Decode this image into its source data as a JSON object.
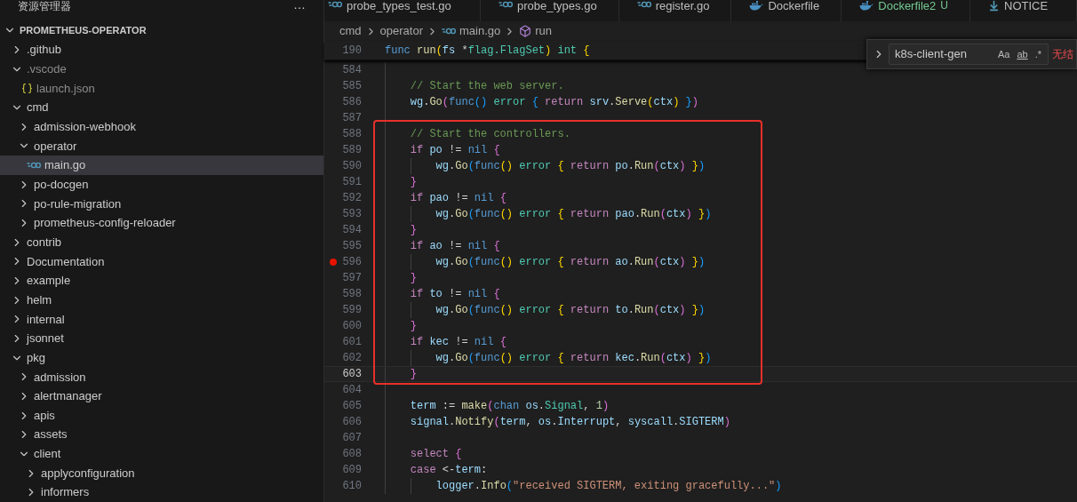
{
  "sidebar": {
    "title": "资源管理器",
    "more_button": "…",
    "root": {
      "title": "PROMETHEUS-OPERATOR",
      "expanded": true
    },
    "items": [
      {
        "name": ".github",
        "kind": "folder",
        "expanded": false,
        "selected": false,
        "dimmed": false
      },
      {
        "name": ".vscode",
        "kind": "folder",
        "expanded": true,
        "selected": false,
        "dimmed": true,
        "children": [
          {
            "name": "launch.json",
            "kind": "json",
            "selected": false,
            "dimmed": true
          }
        ]
      },
      {
        "name": "cmd",
        "kind": "folder",
        "expanded": true,
        "selected": false,
        "dimmed": false,
        "children": [
          {
            "name": "admission-webhook",
            "kind": "folder",
            "expanded": false,
            "selected": false,
            "dimmed": false
          },
          {
            "name": "operator",
            "kind": "folder",
            "expanded": true,
            "selected": false,
            "dimmed": false,
            "children": [
              {
                "name": "main.go",
                "kind": "go",
                "selected": true,
                "dimmed": false
              }
            ]
          },
          {
            "name": "po-docgen",
            "kind": "folder",
            "expanded": false,
            "selected": false,
            "dimmed": false
          },
          {
            "name": "po-rule-migration",
            "kind": "folder",
            "expanded": false,
            "selected": false,
            "dimmed": false
          },
          {
            "name": "prometheus-config-reloader",
            "kind": "folder",
            "expanded": false,
            "selected": false,
            "dimmed": false
          }
        ]
      },
      {
        "name": "contrib",
        "kind": "folder",
        "expanded": false,
        "selected": false,
        "dimmed": false
      },
      {
        "name": "Documentation",
        "kind": "folder",
        "expanded": false,
        "selected": false,
        "dimmed": false
      },
      {
        "name": "example",
        "kind": "folder",
        "expanded": false,
        "selected": false,
        "dimmed": false
      },
      {
        "name": "helm",
        "kind": "folder",
        "expanded": false,
        "selected": false,
        "dimmed": false
      },
      {
        "name": "internal",
        "kind": "folder",
        "expanded": false,
        "selected": false,
        "dimmed": false
      },
      {
        "name": "jsonnet",
        "kind": "folder",
        "expanded": false,
        "selected": false,
        "dimmed": false
      },
      {
        "name": "pkg",
        "kind": "folder",
        "expanded": true,
        "selected": false,
        "dimmed": false,
        "children": [
          {
            "name": "admission",
            "kind": "folder",
            "expanded": false,
            "selected": false,
            "dimmed": false
          },
          {
            "name": "alertmanager",
            "kind": "folder",
            "expanded": false,
            "selected": false,
            "dimmed": false
          },
          {
            "name": "apis",
            "kind": "folder",
            "expanded": false,
            "selected": false,
            "dimmed": false
          },
          {
            "name": "assets",
            "kind": "folder",
            "expanded": false,
            "selected": false,
            "dimmed": false
          },
          {
            "name": "client",
            "kind": "folder",
            "expanded": true,
            "selected": false,
            "dimmed": false,
            "children": [
              {
                "name": "applyconfiguration",
                "kind": "folder",
                "expanded": false,
                "selected": false,
                "dimmed": false
              },
              {
                "name": "informers",
                "kind": "folder",
                "expanded": false,
                "selected": false,
                "dimmed": false
              }
            ]
          }
        ]
      }
    ]
  },
  "tabs": [
    {
      "label": "probe_types_test.go",
      "kind": "go",
      "untracked": false
    },
    {
      "label": "probe_types.go",
      "kind": "go",
      "untracked": false
    },
    {
      "label": "register.go",
      "kind": "go",
      "untracked": false
    },
    {
      "label": "Dockerfile",
      "kind": "docker",
      "untracked": false
    },
    {
      "label": "Dockerfile2",
      "kind": "docker",
      "untracked": true,
      "badge": "U"
    },
    {
      "label": "NOTICE",
      "kind": "notice",
      "untracked": false
    }
  ],
  "breadcrumbs": [
    {
      "label": "cmd",
      "kind": "folder"
    },
    {
      "label": "operator",
      "kind": "folder"
    },
    {
      "label": "main.go",
      "kind": "go"
    },
    {
      "label": "run",
      "kind": "symbol"
    }
  ],
  "sticky_line": {
    "number": "190",
    "tokens": [
      {
        "text": "func ",
        "kind": "ctrl"
      },
      {
        "text": "run",
        "kind": "fn"
      },
      {
        "text": "(",
        "kind": "b1"
      },
      {
        "text": "fs ",
        "kind": "var"
      },
      {
        "text": "*",
        "kind": "plain"
      },
      {
        "text": "flag.FlagSet",
        "kind": "type"
      },
      {
        "text": ")",
        "kind": "b1"
      },
      {
        "text": " int ",
        "kind": "type"
      },
      {
        "text": "{",
        "kind": "b1"
      }
    ]
  },
  "find_widget": {
    "query": "k8s-client-gen",
    "options": [
      {
        "label": "Aa",
        "on": false
      },
      {
        "label": "ab",
        "on": false
      },
      {
        "label": ".*",
        "on": false
      }
    ],
    "result": "无结"
  },
  "lines": [
    {
      "number": "584",
      "breakpoint": false,
      "current": false
    },
    {
      "number": "585",
      "breakpoint": false,
      "current": false,
      "tokens": [
        {
          "text": "    // Start the web server.",
          "kind": "comment"
        }
      ]
    },
    {
      "number": "586",
      "breakpoint": false,
      "current": false,
      "tokens": [
        {
          "text": "    wg",
          "kind": "var"
        },
        {
          "text": ".",
          "kind": "plain"
        },
        {
          "text": "Go",
          "kind": "fn"
        },
        {
          "text": "(",
          "kind": "b2"
        },
        {
          "text": "func",
          "kind": "ctrl"
        },
        {
          "text": "()",
          "kind": "b3"
        },
        {
          "text": " error ",
          "kind": "type"
        },
        {
          "text": "{",
          "kind": "b3"
        },
        {
          "text": " return ",
          "kind": "kw"
        },
        {
          "text": "srv",
          "kind": "var"
        },
        {
          "text": ".",
          "kind": "plain"
        },
        {
          "text": "Serve",
          "kind": "fn"
        },
        {
          "text": "(",
          "kind": "b1"
        },
        {
          "text": "ctx",
          "kind": "var"
        },
        {
          "text": ")",
          "kind": "b1"
        },
        {
          "text": " }",
          "kind": "b3"
        },
        {
          "text": ")",
          "kind": "b2"
        }
      ]
    },
    {
      "number": "587",
      "breakpoint": false,
      "current": false
    },
    {
      "number": "588",
      "breakpoint": false,
      "current": false,
      "tokens": [
        {
          "text": "    // Start the controllers.",
          "kind": "comment"
        }
      ]
    },
    {
      "number": "589",
      "breakpoint": false,
      "current": false,
      "tokens": [
        {
          "text": "    if ",
          "kind": "kw"
        },
        {
          "text": "po",
          "kind": "var"
        },
        {
          "text": " != ",
          "kind": "plain"
        },
        {
          "text": "nil",
          "kind": "ctrl"
        },
        {
          "text": " {",
          "kind": "b2"
        }
      ]
    },
    {
      "number": "590",
      "breakpoint": false,
      "current": false,
      "tokens": [
        {
          "text": "        wg",
          "kind": "var"
        },
        {
          "text": ".",
          "kind": "plain"
        },
        {
          "text": "Go",
          "kind": "fn"
        },
        {
          "text": "(",
          "kind": "b3"
        },
        {
          "text": "func",
          "kind": "ctrl"
        },
        {
          "text": "()",
          "kind": "b1"
        },
        {
          "text": " error ",
          "kind": "type"
        },
        {
          "text": "{",
          "kind": "b1"
        },
        {
          "text": " return ",
          "kind": "kw"
        },
        {
          "text": "po",
          "kind": "var"
        },
        {
          "text": ".",
          "kind": "plain"
        },
        {
          "text": "Run",
          "kind": "fn"
        },
        {
          "text": "(",
          "kind": "b2"
        },
        {
          "text": "ctx",
          "kind": "var"
        },
        {
          "text": ")",
          "kind": "b2"
        },
        {
          "text": " }",
          "kind": "b1"
        },
        {
          "text": ")",
          "kind": "b3"
        }
      ]
    },
    {
      "number": "591",
      "breakpoint": false,
      "current": false,
      "tokens": [
        {
          "text": "    }",
          "kind": "b2"
        }
      ]
    },
    {
      "number": "592",
      "breakpoint": false,
      "current": false,
      "tokens": [
        {
          "text": "    if ",
          "kind": "kw"
        },
        {
          "text": "pao",
          "kind": "var"
        },
        {
          "text": " != ",
          "kind": "plain"
        },
        {
          "text": "nil",
          "kind": "ctrl"
        },
        {
          "text": " {",
          "kind": "b2"
        }
      ]
    },
    {
      "number": "593",
      "breakpoint": false,
      "current": false,
      "tokens": [
        {
          "text": "        wg",
          "kind": "var"
        },
        {
          "text": ".",
          "kind": "plain"
        },
        {
          "text": "Go",
          "kind": "fn"
        },
        {
          "text": "(",
          "kind": "b3"
        },
        {
          "text": "func",
          "kind": "ctrl"
        },
        {
          "text": "()",
          "kind": "b1"
        },
        {
          "text": " error ",
          "kind": "type"
        },
        {
          "text": "{",
          "kind": "b1"
        },
        {
          "text": " return ",
          "kind": "kw"
        },
        {
          "text": "pao",
          "kind": "var"
        },
        {
          "text": ".",
          "kind": "plain"
        },
        {
          "text": "Run",
          "kind": "fn"
        },
        {
          "text": "(",
          "kind": "b2"
        },
        {
          "text": "ctx",
          "kind": "var"
        },
        {
          "text": ")",
          "kind": "b2"
        },
        {
          "text": " }",
          "kind": "b1"
        },
        {
          "text": ")",
          "kind": "b3"
        }
      ]
    },
    {
      "number": "594",
      "breakpoint": false,
      "current": false,
      "tokens": [
        {
          "text": "    }",
          "kind": "b2"
        }
      ]
    },
    {
      "number": "595",
      "breakpoint": false,
      "current": false,
      "tokens": [
        {
          "text": "    if ",
          "kind": "kw"
        },
        {
          "text": "ao",
          "kind": "var"
        },
        {
          "text": " != ",
          "kind": "plain"
        },
        {
          "text": "nil",
          "kind": "ctrl"
        },
        {
          "text": " {",
          "kind": "b2"
        }
      ]
    },
    {
      "number": "596",
      "breakpoint": true,
      "current": false,
      "tokens": [
        {
          "text": "        wg",
          "kind": "var"
        },
        {
          "text": ".",
          "kind": "plain"
        },
        {
          "text": "Go",
          "kind": "fn"
        },
        {
          "text": "(",
          "kind": "b3"
        },
        {
          "text": "func",
          "kind": "ctrl"
        },
        {
          "text": "()",
          "kind": "b1"
        },
        {
          "text": " error ",
          "kind": "type"
        },
        {
          "text": "{",
          "kind": "b1"
        },
        {
          "text": " return ",
          "kind": "kw"
        },
        {
          "text": "ao",
          "kind": "var"
        },
        {
          "text": ".",
          "kind": "plain"
        },
        {
          "text": "Run",
          "kind": "fn"
        },
        {
          "text": "(",
          "kind": "b2"
        },
        {
          "text": "ctx",
          "kind": "var"
        },
        {
          "text": ")",
          "kind": "b2"
        },
        {
          "text": " }",
          "kind": "b1"
        },
        {
          "text": ")",
          "kind": "b3"
        }
      ]
    },
    {
      "number": "597",
      "breakpoint": false,
      "current": false,
      "tokens": [
        {
          "text": "    }",
          "kind": "b2"
        }
      ]
    },
    {
      "number": "598",
      "breakpoint": false,
      "current": false,
      "tokens": [
        {
          "text": "    if ",
          "kind": "kw"
        },
        {
          "text": "to",
          "kind": "var"
        },
        {
          "text": " != ",
          "kind": "plain"
        },
        {
          "text": "nil",
          "kind": "ctrl"
        },
        {
          "text": " {",
          "kind": "b2"
        }
      ]
    },
    {
      "number": "599",
      "breakpoint": false,
      "current": false,
      "tokens": [
        {
          "text": "        wg",
          "kind": "var"
        },
        {
          "text": ".",
          "kind": "plain"
        },
        {
          "text": "Go",
          "kind": "fn"
        },
        {
          "text": "(",
          "kind": "b3"
        },
        {
          "text": "func",
          "kind": "ctrl"
        },
        {
          "text": "()",
          "kind": "b1"
        },
        {
          "text": " error ",
          "kind": "type"
        },
        {
          "text": "{",
          "kind": "b1"
        },
        {
          "text": " return ",
          "kind": "kw"
        },
        {
          "text": "to",
          "kind": "var"
        },
        {
          "text": ".",
          "kind": "plain"
        },
        {
          "text": "Run",
          "kind": "fn"
        },
        {
          "text": "(",
          "kind": "b2"
        },
        {
          "text": "ctx",
          "kind": "var"
        },
        {
          "text": ")",
          "kind": "b2"
        },
        {
          "text": " }",
          "kind": "b1"
        },
        {
          "text": ")",
          "kind": "b3"
        }
      ]
    },
    {
      "number": "600",
      "breakpoint": false,
      "current": false,
      "tokens": [
        {
          "text": "    }",
          "kind": "b2"
        }
      ]
    },
    {
      "number": "601",
      "breakpoint": false,
      "current": false,
      "tokens": [
        {
          "text": "    if ",
          "kind": "kw"
        },
        {
          "text": "kec",
          "kind": "var"
        },
        {
          "text": " != ",
          "kind": "plain"
        },
        {
          "text": "nil",
          "kind": "ctrl"
        },
        {
          "text": " {",
          "kind": "b2"
        }
      ]
    },
    {
      "number": "602",
      "breakpoint": false,
      "current": false,
      "tokens": [
        {
          "text": "        wg",
          "kind": "var"
        },
        {
          "text": ".",
          "kind": "plain"
        },
        {
          "text": "Go",
          "kind": "fn"
        },
        {
          "text": "(",
          "kind": "b3"
        },
        {
          "text": "func",
          "kind": "ctrl"
        },
        {
          "text": "()",
          "kind": "b1"
        },
        {
          "text": " error ",
          "kind": "type"
        },
        {
          "text": "{",
          "kind": "b1"
        },
        {
          "text": " return ",
          "kind": "kw"
        },
        {
          "text": "kec",
          "kind": "var"
        },
        {
          "text": ".",
          "kind": "plain"
        },
        {
          "text": "Run",
          "kind": "fn"
        },
        {
          "text": "(",
          "kind": "b2"
        },
        {
          "text": "ctx",
          "kind": "var"
        },
        {
          "text": ")",
          "kind": "b2"
        },
        {
          "text": " }",
          "kind": "b1"
        },
        {
          "text": ")",
          "kind": "b3"
        }
      ]
    },
    {
      "number": "603",
      "breakpoint": false,
      "current": true,
      "tokens": [
        {
          "text": "    }",
          "kind": "b2"
        }
      ]
    },
    {
      "number": "604",
      "breakpoint": false,
      "current": false
    },
    {
      "number": "605",
      "breakpoint": false,
      "current": false,
      "tokens": [
        {
          "text": "    term",
          "kind": "var"
        },
        {
          "text": " := ",
          "kind": "plain"
        },
        {
          "text": "make",
          "kind": "fn"
        },
        {
          "text": "(",
          "kind": "b2"
        },
        {
          "text": "chan ",
          "kind": "ctrl"
        },
        {
          "text": "os",
          "kind": "var"
        },
        {
          "text": ".",
          "kind": "plain"
        },
        {
          "text": "Signal",
          "kind": "type"
        },
        {
          "text": ", ",
          "kind": "plain"
        },
        {
          "text": "1",
          "kind": "num"
        },
        {
          "text": ")",
          "kind": "b2"
        }
      ]
    },
    {
      "number": "606",
      "breakpoint": false,
      "current": false,
      "tokens": [
        {
          "text": "    signal",
          "kind": "var"
        },
        {
          "text": ".",
          "kind": "plain"
        },
        {
          "text": "Notify",
          "kind": "fn"
        },
        {
          "text": "(",
          "kind": "b2"
        },
        {
          "text": "term",
          "kind": "var"
        },
        {
          "text": ", ",
          "kind": "plain"
        },
        {
          "text": "os",
          "kind": "var"
        },
        {
          "text": ".",
          "kind": "plain"
        },
        {
          "text": "Interrupt",
          "kind": "var"
        },
        {
          "text": ", ",
          "kind": "plain"
        },
        {
          "text": "syscall",
          "kind": "var"
        },
        {
          "text": ".",
          "kind": "plain"
        },
        {
          "text": "SIGTERM",
          "kind": "var"
        },
        {
          "text": ")",
          "kind": "b2"
        }
      ]
    },
    {
      "number": "607",
      "breakpoint": false,
      "current": false
    },
    {
      "number": "608",
      "breakpoint": false,
      "current": false,
      "tokens": [
        {
          "text": "    select ",
          "kind": "kw"
        },
        {
          "text": "{",
          "kind": "b2"
        }
      ]
    },
    {
      "number": "609",
      "breakpoint": false,
      "current": false,
      "tokens": [
        {
          "text": "    case ",
          "kind": "kw"
        },
        {
          "text": "<-",
          "kind": "plain"
        },
        {
          "text": "term",
          "kind": "var"
        },
        {
          "text": ":",
          "kind": "plain"
        }
      ]
    },
    {
      "number": "610",
      "breakpoint": false,
      "current": false,
      "tokens": [
        {
          "text": "        logger",
          "kind": "var"
        },
        {
          "text": ".",
          "kind": "plain"
        },
        {
          "text": "Info",
          "kind": "fn"
        },
        {
          "text": "(",
          "kind": "b3"
        },
        {
          "text": "\"received SIGTERM, exiting gracefully...\"",
          "kind": "str"
        },
        {
          "text": ")",
          "kind": "b3"
        }
      ]
    }
  ]
}
